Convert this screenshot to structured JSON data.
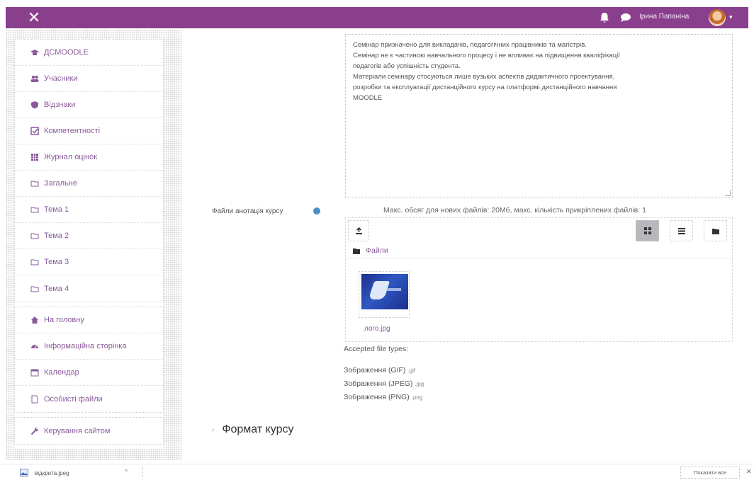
{
  "topbar": {
    "close_glyph": "✕",
    "user_name": "Ірина Папаніна",
    "caret": "▾",
    "icons": [
      "bell-icon",
      "chat-icon",
      "avatar"
    ],
    "color": "#8a3f8c"
  },
  "nav": {
    "groups": [
      {
        "items": [
          {
            "label": "ДСМOODLE",
            "icon": "graduation-cap-icon"
          },
          {
            "label": "Учасники",
            "icon": "users-icon"
          },
          {
            "label": "Відзнаки",
            "icon": "shield-icon"
          },
          {
            "label": "Компетентності",
            "icon": "checkbox-icon"
          },
          {
            "label": "Журнал оцінок",
            "icon": "grid-icon"
          },
          {
            "label": "Загальне",
            "icon": "folder-icon"
          },
          {
            "label": "Тема 1",
            "icon": "folder-icon"
          },
          {
            "label": "Тема 2",
            "icon": "folder-icon"
          },
          {
            "label": "Тема 3",
            "icon": "folder-icon"
          },
          {
            "label": "Тема 4",
            "icon": "folder-icon"
          }
        ]
      },
      {
        "items": [
          {
            "label": "На головну",
            "icon": "home-icon"
          },
          {
            "label": "Інформаційна сторінка",
            "icon": "dashboard-icon"
          },
          {
            "label": "Календар",
            "icon": "calendar-icon"
          },
          {
            "label": "Особисті файли",
            "icon": "file-icon"
          }
        ]
      },
      {
        "items": [
          {
            "label": "Керування сайтом",
            "icon": "wrench-icon"
          }
        ]
      }
    ]
  },
  "summary": {
    "lines": [
      "Семінар призначено для викладачів, педагогічних працівників та магістрів.",
      "Семінар не є частиною навчального процесу і не впливає на підвищення кваліфікації",
      "педагогів або успішність студента.",
      "Матеріали семінару стосуються лише вузьких аспектів дидактичного проектування,",
      "розробки та експлуатації дистанційного курсу на платформі дистанційного навчання",
      "MOODLE"
    ]
  },
  "files": {
    "label": "Файли анотація курсу",
    "max_size_text": "Макс. обсяг для нових файлів: 20Мб, макс. кількість прикріплених файлів: 1",
    "path_label": "Файли",
    "file_name": "лого.jpg",
    "accepted_label": "Accepted file types:",
    "types": [
      {
        "name": "Зображення (GIF)",
        "ext": ".gif"
      },
      {
        "name": "Зображення (JPEG)",
        "ext": ".jpg"
      },
      {
        "name": "Зображення (PNG)",
        "ext": ".png"
      }
    ]
  },
  "section": {
    "chevron": "›",
    "title": "Формат курсу"
  },
  "downloads": {
    "file_name": "відкрита.jpeg",
    "caret": "^",
    "show_all": "Показати все",
    "close": "✕"
  }
}
